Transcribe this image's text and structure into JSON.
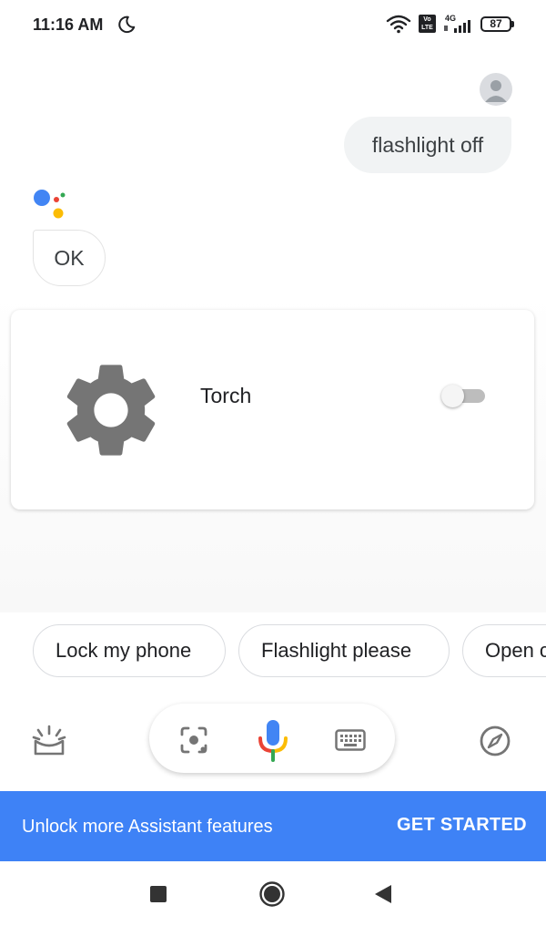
{
  "status_bar": {
    "time": "11:16 AM",
    "volte_badge": "Vo LTE",
    "network_type": "4G",
    "battery": "87",
    "icons": [
      "moon-icon",
      "wifi-icon",
      "volte-icon",
      "signal-icon",
      "battery-icon"
    ]
  },
  "conversation": {
    "user_message": "flashlight off",
    "assistant_reply": "OK"
  },
  "card": {
    "icon": "gear-icon",
    "label": "Torch",
    "toggle_on": false
  },
  "suggestions": [
    "Lock my phone",
    "Flashlight please",
    "Open camera"
  ],
  "input_bar": {
    "icons": [
      "screenshot-icon",
      "lens-icon",
      "mic-icon",
      "keyboard-icon",
      "compass-icon"
    ]
  },
  "banner": {
    "text": "Unlock more Assistant features",
    "action": "GET STARTED"
  },
  "nav": {
    "icons": [
      "recents-icon",
      "home-icon",
      "back-icon"
    ]
  },
  "colors": {
    "banner": "#3e82f6",
    "google_blue": "#4285f4",
    "google_red": "#ea4335",
    "google_yellow": "#fbbc05",
    "google_green": "#34a853",
    "gear": "#757575"
  }
}
